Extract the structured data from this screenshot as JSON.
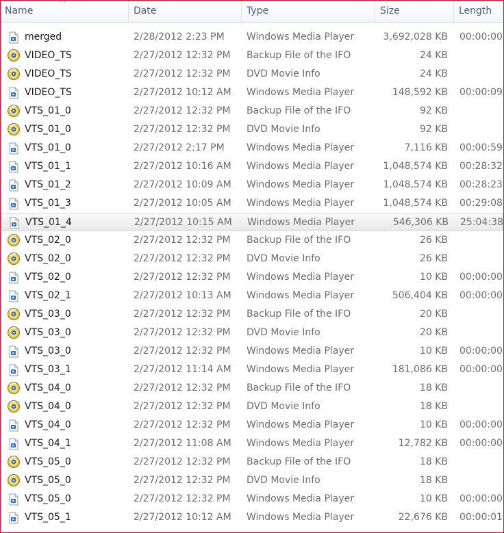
{
  "columns": {
    "name": "Name",
    "date": "Date",
    "type": "Type",
    "size": "Size",
    "length": "Length"
  },
  "selected_index": 10,
  "files": [
    {
      "name": "merged",
      "date": "2/28/2012 2:23 PM",
      "type": "Windows Media Player",
      "size": "3,692,028 KB",
      "length": "00:00:00",
      "icon": "media-file-icon"
    },
    {
      "name": "VIDEO_TS",
      "date": "2/27/2012 12:32 PM",
      "type": "Backup File of the IFO",
      "size": "24 KB",
      "length": "",
      "icon": "disc-file-icon"
    },
    {
      "name": "VIDEO_TS",
      "date": "2/27/2012 12:32 PM",
      "type": "DVD Movie Info",
      "size": "24 KB",
      "length": "",
      "icon": "disc-file-icon"
    },
    {
      "name": "VIDEO_TS",
      "date": "2/27/2012 10:12 AM",
      "type": "Windows Media Player",
      "size": "148,592 KB",
      "length": "00:00:09",
      "icon": "media-file-icon"
    },
    {
      "name": "VTS_01_0",
      "date": "2/27/2012 12:32 PM",
      "type": "Backup File of the IFO",
      "size": "92 KB",
      "length": "",
      "icon": "disc-file-icon"
    },
    {
      "name": "VTS_01_0",
      "date": "2/27/2012 12:32 PM",
      "type": "DVD Movie Info",
      "size": "92 KB",
      "length": "",
      "icon": "disc-file-icon"
    },
    {
      "name": "VTS_01_0",
      "date": "2/27/2012 2:17 PM",
      "type": "Windows Media Player",
      "size": "7,116 KB",
      "length": "00:00:59",
      "icon": "media-file-icon"
    },
    {
      "name": "VTS_01_1",
      "date": "2/27/2012 10:16 AM",
      "type": "Windows Media Player",
      "size": "1,048,574 KB",
      "length": "00:28:32",
      "icon": "media-file-icon"
    },
    {
      "name": "VTS_01_2",
      "date": "2/27/2012 10:09 AM",
      "type": "Windows Media Player",
      "size": "1,048,574 KB",
      "length": "00:28:23",
      "icon": "media-file-icon"
    },
    {
      "name": "VTS_01_3",
      "date": "2/27/2012 10:05 AM",
      "type": "Windows Media Player",
      "size": "1,048,574 KB",
      "length": "00:29:08",
      "icon": "media-file-icon"
    },
    {
      "name": "VTS_01_4",
      "date": "2/27/2012 10:15 AM",
      "type": "Windows Media Player",
      "size": "546,306 KB",
      "length": "25:04:38",
      "icon": "media-file-icon"
    },
    {
      "name": "VTS_02_0",
      "date": "2/27/2012 12:32 PM",
      "type": "Backup File of the IFO",
      "size": "26 KB",
      "length": "",
      "icon": "disc-file-icon"
    },
    {
      "name": "VTS_02_0",
      "date": "2/27/2012 12:32 PM",
      "type": "DVD Movie Info",
      "size": "26 KB",
      "length": "",
      "icon": "disc-file-icon"
    },
    {
      "name": "VTS_02_0",
      "date": "2/27/2012 12:32 PM",
      "type": "Windows Media Player",
      "size": "10 KB",
      "length": "00:00:00",
      "icon": "media-file-icon"
    },
    {
      "name": "VTS_02_1",
      "date": "2/27/2012 10:13 AM",
      "type": "Windows Media Player",
      "size": "506,404 KB",
      "length": "00:00:00",
      "icon": "media-file-icon"
    },
    {
      "name": "VTS_03_0",
      "date": "2/27/2012 12:32 PM",
      "type": "Backup File of the IFO",
      "size": "20 KB",
      "length": "",
      "icon": "disc-file-icon"
    },
    {
      "name": "VTS_03_0",
      "date": "2/27/2012 12:32 PM",
      "type": "DVD Movie Info",
      "size": "20 KB",
      "length": "",
      "icon": "disc-file-icon"
    },
    {
      "name": "VTS_03_0",
      "date": "2/27/2012 12:32 PM",
      "type": "Windows Media Player",
      "size": "10 KB",
      "length": "00:00:00",
      "icon": "media-file-icon"
    },
    {
      "name": "VTS_03_1",
      "date": "2/27/2012 11:14 AM",
      "type": "Windows Media Player",
      "size": "181,086 KB",
      "length": "00:00:00",
      "icon": "media-file-icon"
    },
    {
      "name": "VTS_04_0",
      "date": "2/27/2012 12:32 PM",
      "type": "Backup File of the IFO",
      "size": "18 KB",
      "length": "",
      "icon": "disc-file-icon"
    },
    {
      "name": "VTS_04_0",
      "date": "2/27/2012 12:32 PM",
      "type": "DVD Movie Info",
      "size": "18 KB",
      "length": "",
      "icon": "disc-file-icon"
    },
    {
      "name": "VTS_04_0",
      "date": "2/27/2012 12:32 PM",
      "type": "Windows Media Player",
      "size": "10 KB",
      "length": "00:00:00",
      "icon": "media-file-icon"
    },
    {
      "name": "VTS_04_1",
      "date": "2/27/2012 11:08 AM",
      "type": "Windows Media Player",
      "size": "12,782 KB",
      "length": "00:00:00",
      "icon": "media-file-icon"
    },
    {
      "name": "VTS_05_0",
      "date": "2/27/2012 12:32 PM",
      "type": "Backup File of the IFO",
      "size": "18 KB",
      "length": "",
      "icon": "disc-file-icon"
    },
    {
      "name": "VTS_05_0",
      "date": "2/27/2012 12:32 PM",
      "type": "DVD Movie Info",
      "size": "18 KB",
      "length": "",
      "icon": "disc-file-icon"
    },
    {
      "name": "VTS_05_0",
      "date": "2/27/2012 12:32 PM",
      "type": "Windows Media Player",
      "size": "10 KB",
      "length": "00:00:00",
      "icon": "media-file-icon"
    },
    {
      "name": "VTS_05_1",
      "date": "2/27/2012 10:12 AM",
      "type": "Windows Media Player",
      "size": "22,676 KB",
      "length": "00:00:01",
      "icon": "media-file-icon"
    }
  ]
}
